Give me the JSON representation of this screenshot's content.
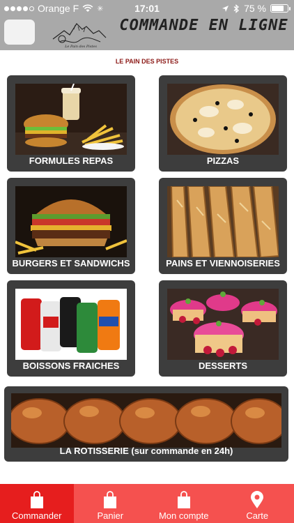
{
  "status_bar": {
    "carrier": "Orange F",
    "time": "17:01",
    "battery": "75 %",
    "battery_level": 0.75
  },
  "header": {
    "title": "COMMANDE EN LIGNE",
    "logo_text": "Le Pain des Pistes"
  },
  "subtitle": "LE PAIN DES PISTES",
  "tiles": [
    {
      "label": "FORMULES REPAS"
    },
    {
      "label": "PIZZAS"
    },
    {
      "label": "BURGERS ET SANDWICHS"
    },
    {
      "label": "PAINS ET VIENNOISERIES"
    },
    {
      "label": "BOISSONS FRAICHES"
    },
    {
      "label": "DESSERTS"
    },
    {
      "label": "LA ROTISSERIE (sur commande en 24h)"
    }
  ],
  "tabs": [
    {
      "label": "Commander",
      "icon": "shopping-bag-icon"
    },
    {
      "label": "Panier",
      "icon": "shopping-bag-icon"
    },
    {
      "label": "Mon compte",
      "icon": "shopping-bag-icon"
    },
    {
      "label": "Carte",
      "icon": "map-pin-icon"
    }
  ],
  "colors": {
    "header_bg": "#a9a9a9",
    "tab_bar": "#f5514f",
    "tab_active": "#e61e1e",
    "tile_bg": "#3d3d3d",
    "subtitle": "#8c1a17"
  }
}
